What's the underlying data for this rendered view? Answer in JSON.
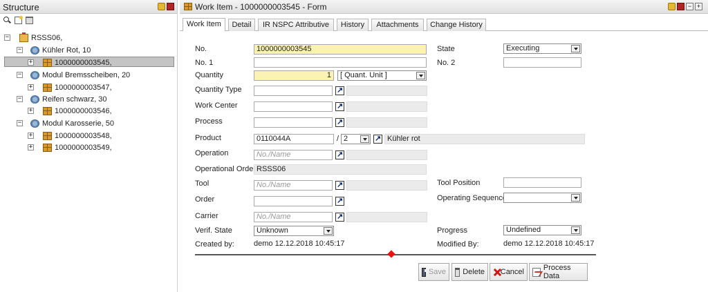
{
  "structure": {
    "title": "Structure",
    "tree": [
      {
        "label": "RSSS06,",
        "icon": "production-order-icon"
      },
      {
        "label": "Kühler Rot, 10",
        "icon": "module-icon"
      },
      {
        "label": "1000000003545,",
        "icon": "work-item-icon"
      },
      {
        "label": "Modul Bremsscheiben, 20",
        "icon": "module-icon"
      },
      {
        "label": "1000000003547,",
        "icon": "work-item-icon"
      },
      {
        "label": "Reifen schwarz, 30",
        "icon": "module-icon"
      },
      {
        "label": "1000000003546,",
        "icon": "work-item-icon"
      },
      {
        "label": "Modul Karosserie, 50",
        "icon": "module-icon"
      },
      {
        "label": "1000000003548,",
        "icon": "work-item-icon"
      },
      {
        "label": "1000000003549,",
        "icon": "work-item-icon"
      }
    ]
  },
  "form": {
    "title": "Work Item - 1000000003545 - Form",
    "tabs": [
      "Work Item",
      "Detail",
      "IR NSPC Attributive",
      "History",
      "Attachments",
      "Change History"
    ],
    "active_tab": "Work Item",
    "labels": {
      "no": "No.",
      "no1": "No. 1",
      "quantity": "Quantity",
      "quantity_type": "Quantity Type",
      "work_center": "Work Center",
      "process": "Process",
      "product": "Product",
      "operation": "Operation",
      "operational_order": "Operational Order",
      "tool": "Tool",
      "order": "Order",
      "carrier": "Carrier",
      "verif_state": "Verif. State",
      "created_by": "Created by:",
      "state": "State",
      "no2": "No. 2",
      "tool_position": "Tool Position",
      "operating_sequence": "Operating Sequence",
      "progress": "Progress",
      "modified_by": "Modified By:"
    },
    "values": {
      "no": "1000000003545",
      "no1": "",
      "quantity": "1",
      "quantity_unit": "[ Quant. Unit ]",
      "product": "0110044A",
      "product_sep": "/",
      "product_version": "2",
      "product_name": "Kühler rot",
      "operation_placeholder": "No./Name",
      "operational_order": "RSSS06",
      "tool_placeholder": "No./Name",
      "carrier_placeholder": "No./Name",
      "verif_state": "Unknown",
      "created_by": "demo 12.12.2018 10:45:17",
      "state": "Executing",
      "no2": "",
      "tool_position": "",
      "operating_sequence": "",
      "progress": "Undefined",
      "modified_by": "demo 12.12.2018 10:45:17"
    },
    "buttons": {
      "save": "Save",
      "delete": "Delete",
      "cancel": "Cancel",
      "process_data": "Process Data"
    }
  },
  "colors": {
    "required_field": "#fbf3b4",
    "selected_tree_row": "#c4c4c4",
    "separator_marker": "#ee1111"
  }
}
